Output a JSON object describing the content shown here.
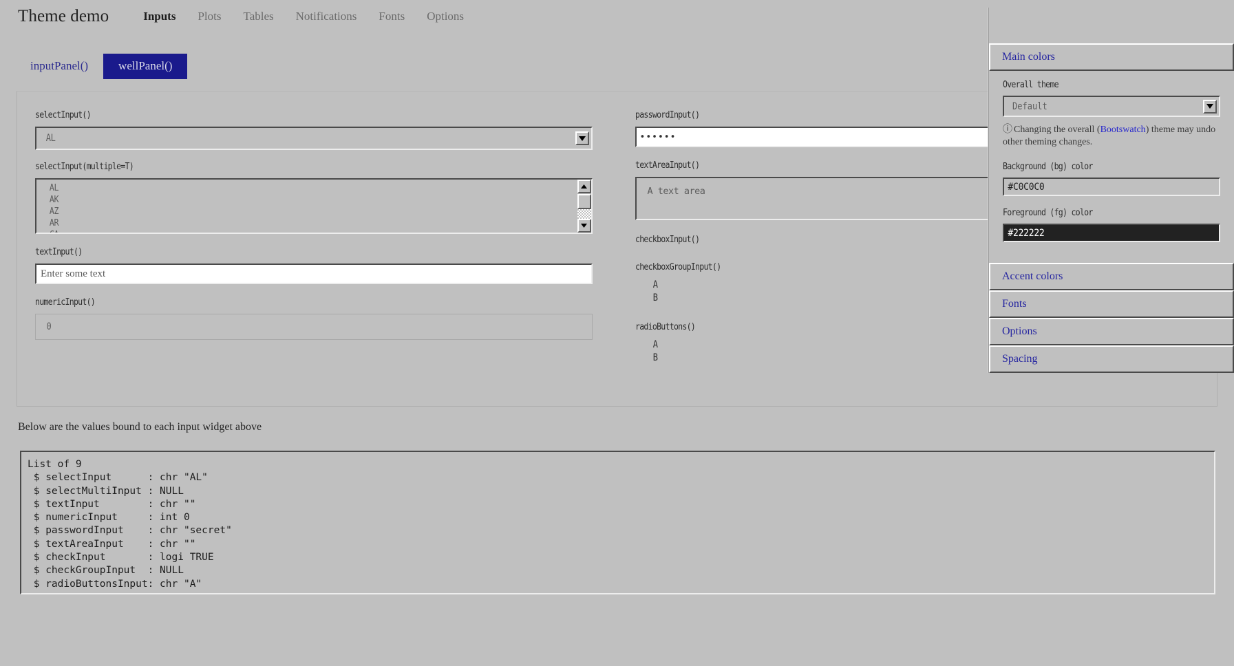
{
  "navbar": {
    "brand": "Theme demo",
    "links": [
      {
        "label": "Inputs",
        "active": true
      },
      {
        "label": "Plots",
        "active": false
      },
      {
        "label": "Tables",
        "active": false
      },
      {
        "label": "Notifications",
        "active": false
      },
      {
        "label": "Fonts",
        "active": false
      },
      {
        "label": "Options",
        "active": false
      }
    ]
  },
  "tabs": [
    {
      "label": "inputPanel()",
      "active": false
    },
    {
      "label": "wellPanel()",
      "active": true
    }
  ],
  "left_col": {
    "select": {
      "label": "selectInput()",
      "value": "AL",
      "arrow_icon": "chevron-down-icon"
    },
    "select_multi": {
      "label": "selectInput(multiple=T)",
      "options": [
        "AL",
        "AK",
        "AZ",
        "AR",
        "CA"
      ],
      "scroll_up_icon": "triangle-up-icon",
      "scroll_down_icon": "triangle-down-icon"
    },
    "text": {
      "label": "textInput()",
      "value": "",
      "placeholder": "Enter some text"
    },
    "numeric": {
      "label": "numericInput()",
      "value": "0"
    }
  },
  "right_col": {
    "password": {
      "label": "passwordInput()",
      "value": "••••••"
    },
    "textarea": {
      "label": "textAreaInput()",
      "value": "",
      "placeholder": "A text area"
    },
    "checkbox": {
      "label": "checkboxInput()"
    },
    "checkbox_group": {
      "label": "checkboxGroupInput()",
      "options": [
        "A",
        "B"
      ]
    },
    "radio_buttons": {
      "label": "radioButtons()",
      "options": [
        "A",
        "B"
      ]
    }
  },
  "below": {
    "caption": "Below are the values bound to each input widget above",
    "verbatim": "List of 9\n $ selectInput      : chr \"AL\"\n $ selectMultiInput : NULL\n $ textInput        : chr \"\"\n $ numericInput     : int 0\n $ passwordInput    : chr \"secret\"\n $ textAreaInput    : chr \"\"\n $ checkInput       : logi TRUE\n $ checkGroupInput  : NULL\n $ radioButtonsInput: chr \"A\""
  },
  "themer": {
    "main_colors_header": "Main colors",
    "overall_theme": {
      "label": "Overall theme",
      "value": "Default",
      "arrow_icon": "chevron-down-icon"
    },
    "help": {
      "icon": "info-circle-icon",
      "prefix": "Changing the overall (",
      "link": "Bootswatch",
      "suffix": ") theme may undo other theming changes."
    },
    "bg": {
      "label": "Background (bg) color",
      "value": "#C0C0C0"
    },
    "fg": {
      "label": "Foreground (fg) color",
      "value": "#222222"
    },
    "sections": [
      {
        "label": "Accent colors"
      },
      {
        "label": "Fonts"
      },
      {
        "label": "Options"
      },
      {
        "label": "Spacing"
      }
    ]
  },
  "colors": {
    "bg": "#C0C0C0",
    "fg": "#222222",
    "accent_navy": "#1A1A8C",
    "link_blue": "#2525CC"
  }
}
